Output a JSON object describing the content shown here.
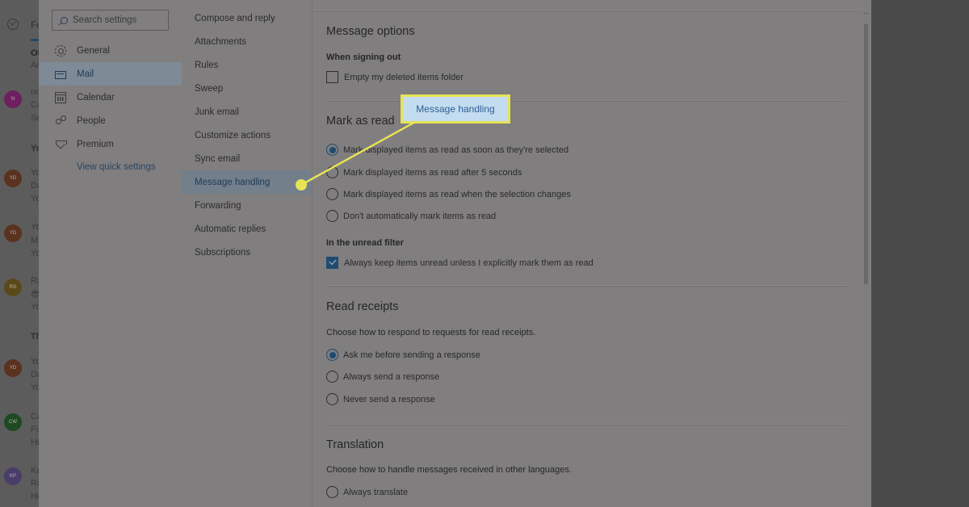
{
  "background_mail_list": {
    "tab_fragment": "Fo",
    "items": [
      {
        "avatar": "",
        "line1": "Ot",
        "line2": "Ar",
        "bold": true
      },
      {
        "avatar": "N",
        "avatar_color": "#6e1f5f",
        "line1": "no",
        "line2": "Ca",
        "line3": "Se"
      },
      {
        "group": "Ye"
      },
      {
        "avatar": "YD",
        "avatar_color": "#5a3220",
        "line1": "Yo",
        "line2": "Da",
        "line3": "Yo"
      },
      {
        "avatar": "YD",
        "avatar_color": "#5a3220",
        "line1": "Yo",
        "line2": "M",
        "line3": "Yo"
      },
      {
        "avatar": "RG",
        "avatar_color": "#5a4a1a",
        "line1": "Ra",
        "line2": "😎",
        "line3": "Yo"
      },
      {
        "group": "Th"
      },
      {
        "avatar": "YD",
        "avatar_color": "#5a3220",
        "line1": "Yo",
        "line2": "Da",
        "line3": "Yo"
      },
      {
        "avatar": "CW",
        "avatar_color": "#1f4a22",
        "line1": "Ca",
        "line2": "Fu",
        "line3": "Hi"
      },
      {
        "avatar": "KP",
        "avatar_color": "#4a3d6a",
        "line1": "Ka",
        "line2": "Re",
        "line3": "Hi"
      }
    ]
  },
  "settings": {
    "search": {
      "placeholder": "Search settings",
      "icon": "search-icon"
    },
    "categories": [
      {
        "label": "General",
        "icon": "gear-icon",
        "active": false
      },
      {
        "label": "Mail",
        "icon": "mail-icon",
        "active": true
      },
      {
        "label": "Calendar",
        "icon": "calendar-icon",
        "active": false
      },
      {
        "label": "People",
        "icon": "people-icon",
        "active": false
      },
      {
        "label": "Premium",
        "icon": "diamond-icon",
        "active": false
      }
    ],
    "quick_settings_link": "View quick settings",
    "mail_subsections": [
      {
        "label": "Compose and reply",
        "active": false
      },
      {
        "label": "Attachments",
        "active": false
      },
      {
        "label": "Rules",
        "active": false
      },
      {
        "label": "Sweep",
        "active": false
      },
      {
        "label": "Junk email",
        "active": false
      },
      {
        "label": "Customize actions",
        "active": false
      },
      {
        "label": "Sync email",
        "active": false
      },
      {
        "label": "Message handling",
        "active": true
      },
      {
        "label": "Forwarding",
        "active": false
      },
      {
        "label": "Automatic replies",
        "active": false
      },
      {
        "label": "Subscriptions",
        "active": false
      }
    ]
  },
  "content": {
    "message_options": {
      "title": "Message options",
      "subtitle": "When signing out",
      "checkbox": {
        "label": "Empty my deleted items folder",
        "checked": false
      }
    },
    "mark_as_read": {
      "title": "Mark as read",
      "options": [
        {
          "label": "Mark displayed items as read as soon as they're selected",
          "selected": true
        },
        {
          "label": "Mark displayed items as read after 5 seconds",
          "selected": false
        },
        {
          "label": "Mark displayed items as read when the selection changes",
          "selected": false
        },
        {
          "label": "Don't automatically mark items as read",
          "selected": false
        }
      ],
      "unread_filter": {
        "subtitle": "In the unread filter",
        "checkbox": {
          "label": "Always keep items unread unless I explicitly mark them as read",
          "checked": true
        }
      }
    },
    "read_receipts": {
      "title": "Read receipts",
      "description": "Choose how to respond to requests for read receipts.",
      "options": [
        {
          "label": "Ask me before sending a response",
          "selected": true
        },
        {
          "label": "Always send a response",
          "selected": false
        },
        {
          "label": "Never send a response",
          "selected": false
        }
      ]
    },
    "translation": {
      "title": "Translation",
      "description": "Choose how to handle messages received in other languages.",
      "options": [
        {
          "label": "Always translate",
          "selected": false
        }
      ]
    }
  },
  "callout": {
    "label": "Message handling",
    "border_color": "#e6e356",
    "fill_color": "#c4dcf0",
    "text_color": "#2c5f93"
  },
  "colors": {
    "accent": "#1f4b70",
    "dimmed_panel": "#807e7f",
    "overlay_dark": "#4b4a4a"
  }
}
